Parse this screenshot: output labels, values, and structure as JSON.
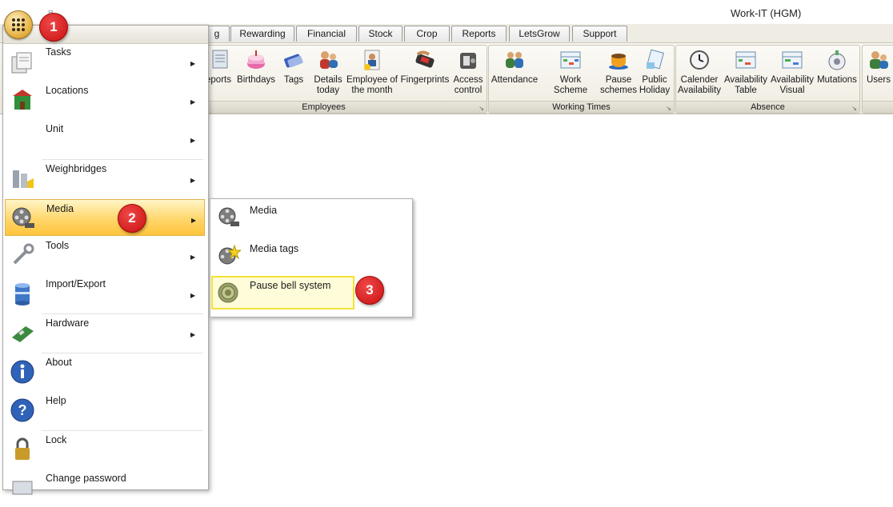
{
  "window": {
    "title": "Work-IT (HGM)"
  },
  "quick_access": {
    "glyph": "⊟"
  },
  "tabs": [
    {
      "label": "g"
    },
    {
      "label": "Rewarding"
    },
    {
      "label": "Financial"
    },
    {
      "label": "Stock"
    },
    {
      "label": "Crop"
    },
    {
      "label": "Reports"
    },
    {
      "label": "LetsGrow"
    },
    {
      "label": "Support"
    }
  ],
  "ribbon": {
    "groups": [
      {
        "label": "Employees"
      },
      {
        "label": "Working Times"
      },
      {
        "label": "Absence"
      }
    ],
    "buttons": [
      {
        "label": "eports",
        "icon": "reports-icon"
      },
      {
        "label": "Birthdays",
        "icon": "birthday-cake-icon"
      },
      {
        "label": "Tags",
        "icon": "tags-icon"
      },
      {
        "label": "Details\ntoday",
        "line1": "Details",
        "line2": "today",
        "icon": "people-details-icon"
      },
      {
        "label": "Employee of the month",
        "line1": "Employee of",
        "line2": "the month",
        "icon": "employee-award-icon"
      },
      {
        "label": "Fingerprints",
        "icon": "fingerprint-scanner-icon"
      },
      {
        "label": "Access control",
        "line1": "Access",
        "line2": "control",
        "icon": "access-control-icon"
      },
      {
        "label": "Attendance",
        "icon": "attendance-icon"
      },
      {
        "label": "Work Scheme",
        "icon": "work-scheme-icon"
      },
      {
        "label": "Pause schemes",
        "line1": "Pause",
        "line2": "schemes",
        "icon": "coffee-cup-icon"
      },
      {
        "label": "Public Holiday",
        "line1": "Public",
        "line2": "Holiday",
        "icon": "public-holiday-icon"
      },
      {
        "label": "Calender Availability",
        "line1": "Calender",
        "line2": "Availability",
        "icon": "clock-icon"
      },
      {
        "label": "Availability Table",
        "line1": "Availability",
        "line2": "Table",
        "icon": "availability-table-icon"
      },
      {
        "label": "Availability Visual",
        "line1": "Availability",
        "line2": "Visual",
        "icon": "availability-visual-icon"
      },
      {
        "label": "Mutations",
        "icon": "mutations-icon"
      },
      {
        "label": "Users",
        "icon": "users-icon"
      }
    ]
  },
  "app_menu": {
    "items": [
      {
        "label": "Tasks",
        "icon": "tasks-icon",
        "has_submenu": true
      },
      {
        "label": "Locations",
        "icon": "locations-icon",
        "has_submenu": true
      },
      {
        "label": "Unit",
        "icon": "",
        "has_submenu": true
      },
      {
        "label": "Weighbridges",
        "icon": "weighbridge-icon",
        "has_submenu": true
      },
      {
        "label": "Media",
        "icon": "film-reel-icon",
        "has_submenu": true,
        "selected": true
      },
      {
        "label": "Tools",
        "icon": "wrench-icon",
        "has_submenu": true
      },
      {
        "label": "Import/Export",
        "icon": "database-icon",
        "has_submenu": true
      },
      {
        "label": "Hardware",
        "icon": "hardware-card-icon",
        "has_submenu": true
      },
      {
        "label": "About",
        "icon": "info-icon",
        "has_submenu": false
      },
      {
        "label": "Help",
        "icon": "help-icon",
        "has_submenu": false
      },
      {
        "label": "Lock",
        "icon": "padlock-icon",
        "has_submenu": false
      },
      {
        "label": "Change password",
        "icon": "password-icon",
        "has_submenu": false
      }
    ]
  },
  "submenu": {
    "items": [
      {
        "label": "Media",
        "icon": "film-reel-icon"
      },
      {
        "label": "Media tags",
        "icon": "film-reel-star-icon"
      },
      {
        "label": "Pause bell system",
        "icon": "bell-speaker-icon",
        "highlighted": true
      }
    ]
  },
  "callouts": [
    "1",
    "2",
    "3"
  ],
  "colors": {
    "accent_highlight": "#ffc43c",
    "callout_red": "#d21b1b",
    "submenu_highlight": "#f2e235"
  }
}
